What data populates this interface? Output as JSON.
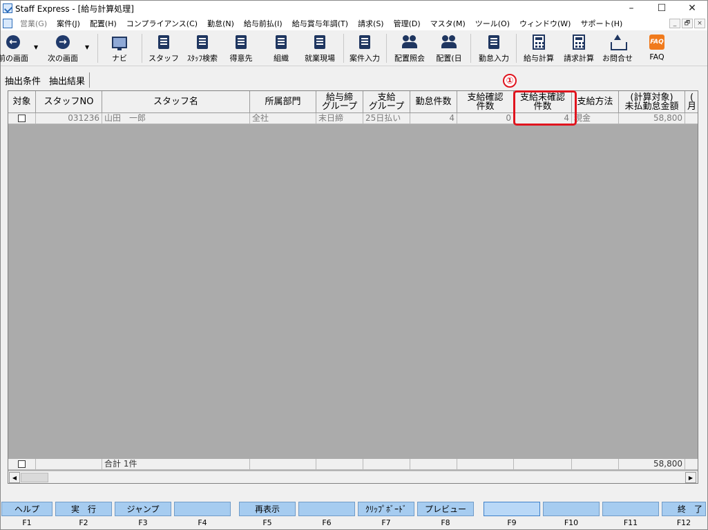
{
  "window": {
    "title": "Staff Express - [給与計算処理]",
    "controls": [
      "–",
      "☐",
      "✕"
    ]
  },
  "menu": {
    "items": [
      {
        "label": "営業(G)",
        "disabled": true
      },
      {
        "label": "案件(J)"
      },
      {
        "label": "配置(H)"
      },
      {
        "label": "コンプライアンス(C)"
      },
      {
        "label": "勤怠(N)"
      },
      {
        "label": "給与前払(I)"
      },
      {
        "label": "給与賞与年調(T)"
      },
      {
        "label": "請求(S)"
      },
      {
        "label": "管理(D)"
      },
      {
        "label": "マスタ(M)"
      },
      {
        "label": "ツール(O)"
      },
      {
        "label": "ウィンドウ(W)"
      },
      {
        "label": "サポート(H)"
      }
    ],
    "mdi_controls": [
      "_",
      "🗗",
      "×"
    ]
  },
  "toolbar": {
    "prev_label": "前の画面",
    "next_label": "次の画面",
    "navi_label": "ナビ",
    "staff_label": "スタッフ",
    "staff_search_label": "ｽﾀｯﾌ検索",
    "client_label": "得意先",
    "org_label": "組織",
    "site_label": "就業現場",
    "case_input_label": "案件入力",
    "placement_inquiry_label": "配置照会",
    "placement_day_label": "配置(日",
    "attendance_input_label": "勤怠入力",
    "payroll_calc_label": "給与計算",
    "invoice_calc_label": "請求計算",
    "inquiry_label": "お問合せ",
    "faq_label": "FAQ",
    "faq_icon_text": "FAQ"
  },
  "tabs": {
    "conditions": "抽出条件",
    "results": "抽出結果"
  },
  "grid": {
    "headers": {
      "target": "対象",
      "staff_no": "スタッフNO",
      "staff_name": "スタッフ名",
      "department": "所属部門",
      "pay_cutoff_group": "給与締\nグループ",
      "payment_group": "支給\nグループ",
      "attendance_count": "勤怠件数",
      "pay_confirmed_count": "支給確認\n件数",
      "pay_unconfirmed_count": "支給未確認\n件数",
      "payment_method": "支給方法",
      "unpaid_amount": "(計算対象)\n未払勤怠金額",
      "month": "(\n月"
    },
    "rows": [
      {
        "staff_no": "031236",
        "staff_name": "山田　一郎",
        "department": "全社",
        "pay_cutoff_group": "末日締",
        "payment_group": "25日払い",
        "attendance_count": "4",
        "pay_confirmed_count": "0",
        "pay_unconfirmed_count": "4",
        "payment_method": "現金",
        "unpaid_amount": "58,800"
      }
    ],
    "total": {
      "label": "合計 1件",
      "unpaid_amount": "58,800"
    },
    "scroll_left": "◀",
    "scroll_right": "▶"
  },
  "annotation": {
    "number": "①",
    "color": "#e0141e"
  },
  "function_keys": [
    {
      "label": "ヘルプ",
      "key": "F1"
    },
    {
      "label": "実　行",
      "key": "F2"
    },
    {
      "label": "ジャンプ",
      "key": "F3"
    },
    {
      "label": "",
      "key": "F4"
    },
    {
      "label": "再表示",
      "key": "F5"
    },
    {
      "label": "",
      "key": "F6"
    },
    {
      "label": "ｸﾘｯﾌﾟﾎﾞｰﾄﾞ",
      "key": "F7"
    },
    {
      "label": "プレビュー",
      "key": "F8"
    },
    {
      "label": "",
      "key": "F9"
    },
    {
      "label": "",
      "key": "F10"
    },
    {
      "label": "",
      "key": "F11"
    },
    {
      "label": "終　了",
      "key": "F12"
    }
  ]
}
